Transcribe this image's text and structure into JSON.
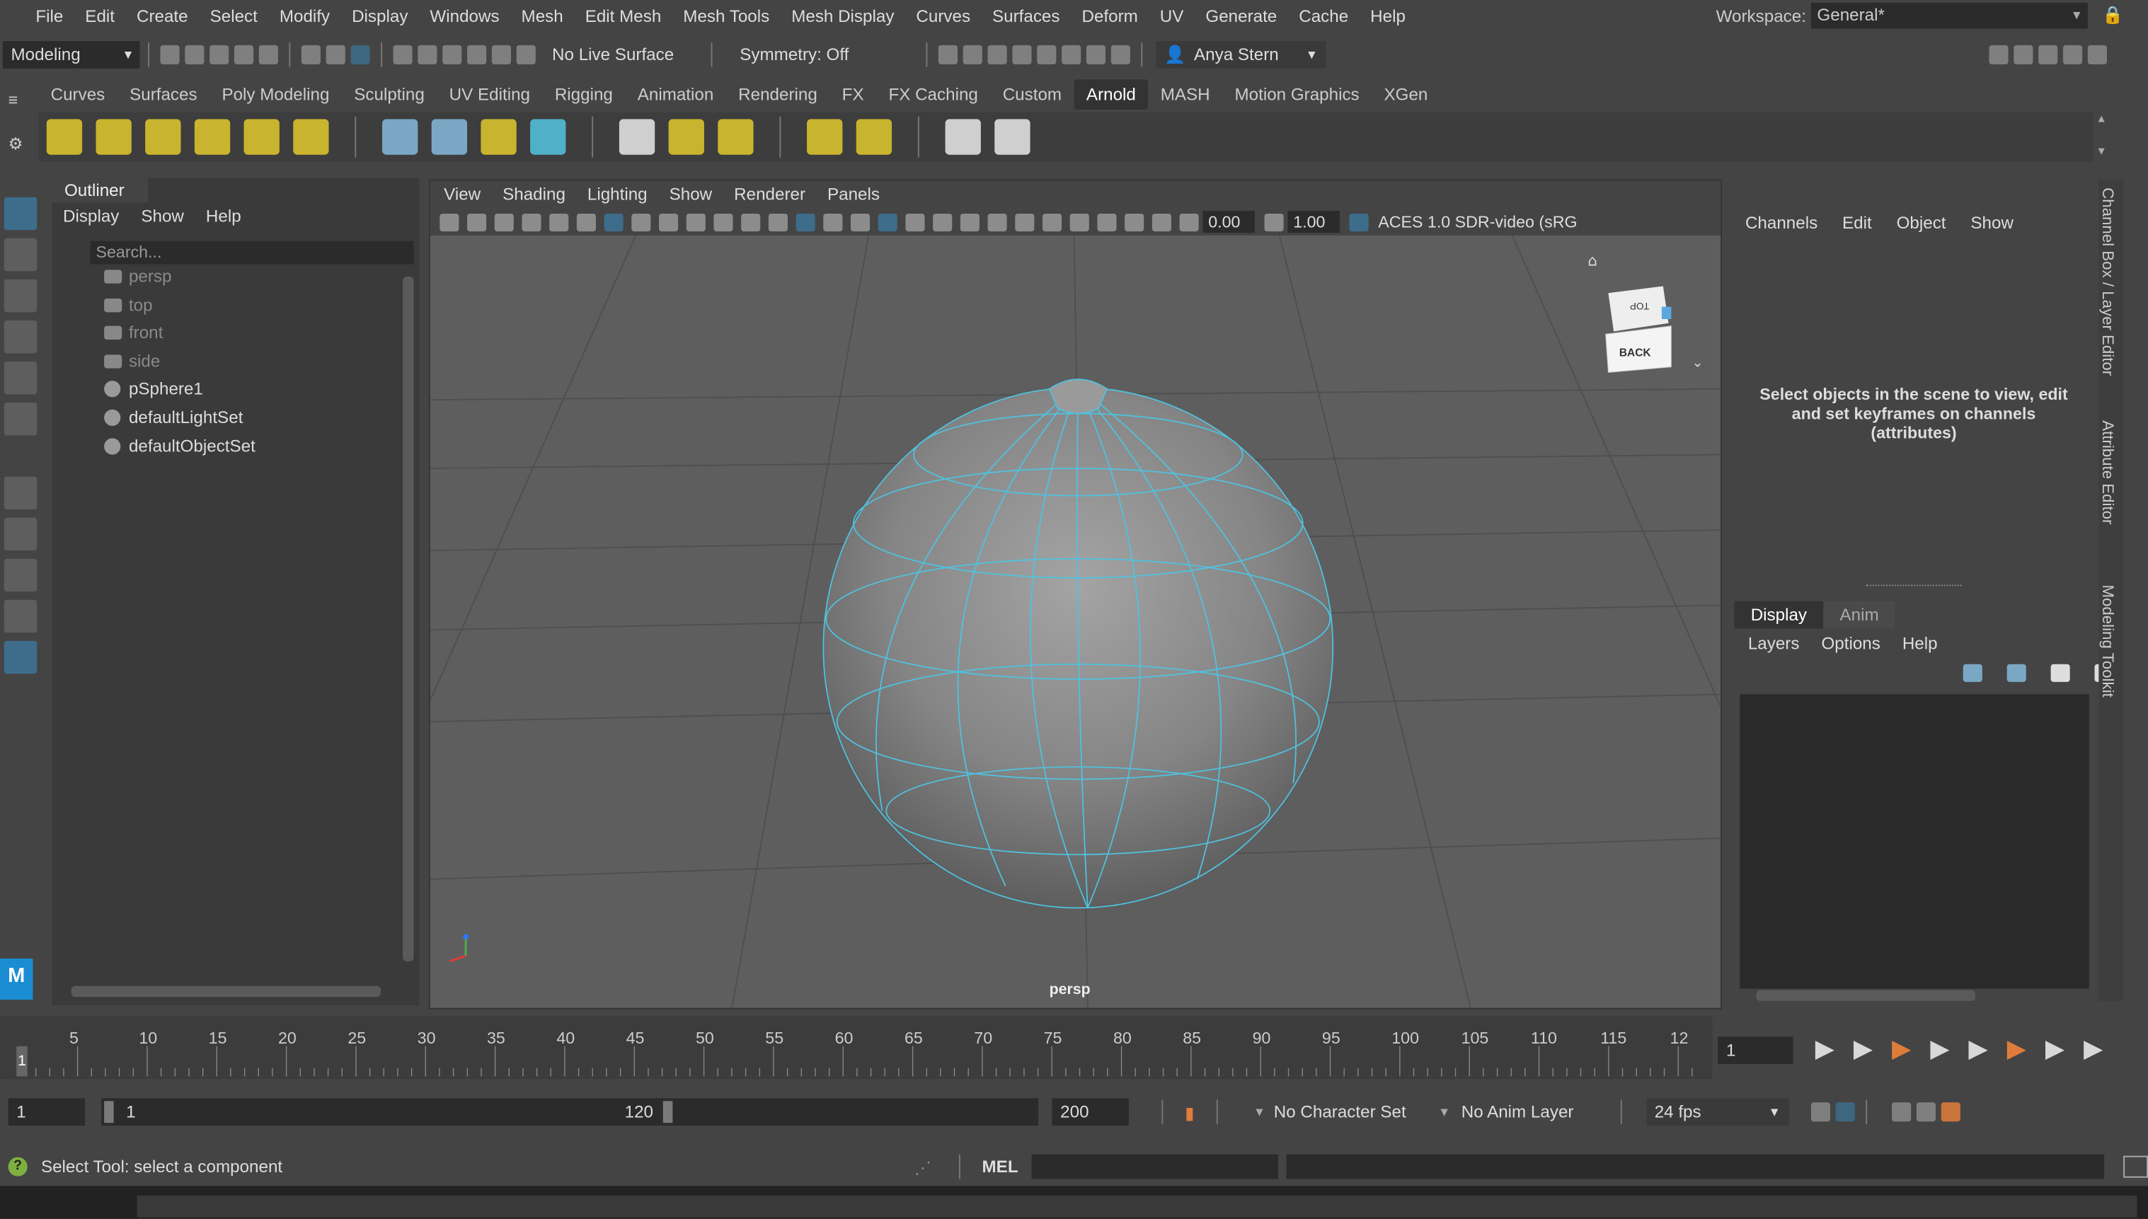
{
  "menubar": [
    "File",
    "Edit",
    "Create",
    "Select",
    "Modify",
    "Display",
    "Windows",
    "Mesh",
    "Edit Mesh",
    "Mesh Tools",
    "Mesh Display",
    "Curves",
    "Surfaces",
    "Deform",
    "UV",
    "Generate",
    "Cache",
    "Help"
  ],
  "workspace": {
    "label": "Workspace:",
    "value": "General*"
  },
  "statusline": {
    "mode": "Modeling",
    "live_surface": "No Live Surface",
    "symmetry": "Symmetry: Off",
    "user": "Anya Stern"
  },
  "shelf": {
    "tabs": [
      "Curves",
      "Surfaces",
      "Poly Modeling",
      "Sculpting",
      "UV Editing",
      "Rigging",
      "Animation",
      "Rendering",
      "FX",
      "FX Caching",
      "Custom",
      "Arnold",
      "MASH",
      "Motion Graphics",
      "XGen"
    ],
    "active": "Arnold"
  },
  "outliner": {
    "title": "Outliner",
    "menu": [
      "Display",
      "Show",
      "Help"
    ],
    "search_placeholder": "Search...",
    "items": [
      {
        "label": "persp",
        "dim": true,
        "icon": "camera-icon"
      },
      {
        "label": "top",
        "dim": true,
        "icon": "camera-icon"
      },
      {
        "label": "front",
        "dim": true,
        "icon": "camera-icon"
      },
      {
        "label": "side",
        "dim": true,
        "icon": "camera-icon"
      },
      {
        "label": "pSphere1",
        "dim": false,
        "icon": "mesh-icon"
      },
      {
        "label": "defaultLightSet",
        "dim": false,
        "icon": "set-icon"
      },
      {
        "label": "defaultObjectSet",
        "dim": false,
        "icon": "set-icon"
      }
    ]
  },
  "viewport": {
    "menu": [
      "View",
      "Shading",
      "Lighting",
      "Show",
      "Renderer",
      "Panels"
    ],
    "exposure": "0.00",
    "gamma": "1.00",
    "colorspace": "ACES 1.0 SDR-video (sRG",
    "camera_label": "persp",
    "cube_top": "TOP",
    "cube_back": "BACK"
  },
  "channelbox": {
    "menu": [
      "Channels",
      "Edit",
      "Object",
      "Show"
    ],
    "hint": "Select objects in the scene to view, edit and set keyframes on channels (attributes)",
    "layer_tabs": [
      "Display",
      "Anim"
    ],
    "layer_menu": [
      "Layers",
      "Options",
      "Help"
    ]
  },
  "side_tabs": [
    "Channel Box / Layer Editor",
    "Attribute Editor",
    "Modeling Toolkit"
  ],
  "timeline": {
    "ticks": [
      "5",
      "10",
      "15",
      "20",
      "25",
      "30",
      "35",
      "40",
      "45",
      "50",
      "55",
      "60",
      "65",
      "70",
      "75",
      "80",
      "85",
      "90",
      "95",
      "100",
      "105",
      "110",
      "115",
      "12"
    ],
    "current": "1",
    "frame_input": "1"
  },
  "range": {
    "start": "1",
    "inner_start": "1",
    "inner_end": "120",
    "end": "200",
    "character_set": "No Character Set",
    "anim_layer": "No Anim Layer",
    "fps": "24 fps"
  },
  "cmdline": {
    "help_text": "Select Tool: select a component",
    "lang": "MEL"
  },
  "colors": {
    "accent": "#4ec3e0",
    "active_tool": "#3d6d8a",
    "help_green": "#7db03f"
  }
}
